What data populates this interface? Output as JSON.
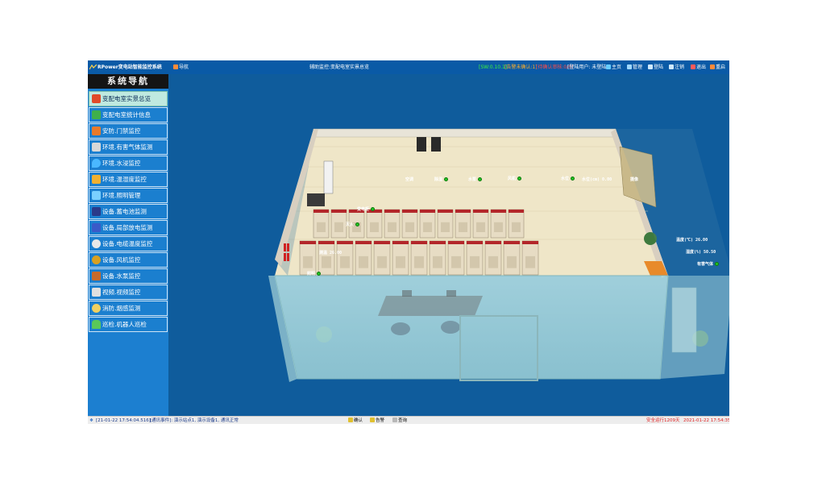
{
  "window": {
    "title": "RPower变电站智能监控系统",
    "nav_button": "导航",
    "center_title": "辅助监控:变配电室实景总览",
    "status_green": "[SW:0.10.1]",
    "status_orange": "[告警未确认:1]",
    "status_red": "[待确认审核:0/0]",
    "login_label": "[登陆用户: 未登陆]",
    "menu": [
      "主页",
      "管理",
      "登陆",
      "注销",
      "退出",
      "重启"
    ]
  },
  "sidebar": {
    "title": "系统导航",
    "items": [
      {
        "label": "变配电室实景总览",
        "icon": "substation-icon",
        "active": true
      },
      {
        "label": "变配电室统计信息",
        "icon": "statistics-icon"
      },
      {
        "label": "安防.门禁监控",
        "icon": "door-access-icon"
      },
      {
        "label": "环境.有害气体监测",
        "icon": "gas-icon"
      },
      {
        "label": "环境.水浸监控",
        "icon": "water-drop-icon"
      },
      {
        "label": "环境.温湿度监控",
        "icon": "thermometer-icon"
      },
      {
        "label": "环境.照明管理",
        "icon": "lighting-icon"
      },
      {
        "label": "设备.蓄电池监测",
        "icon": "battery-icon"
      },
      {
        "label": "设备.局部放电监测",
        "icon": "discharge-icon"
      },
      {
        "label": "设备.电缆温度监控",
        "icon": "cable-gauge-icon"
      },
      {
        "label": "设备.风机监控",
        "icon": "fan-icon"
      },
      {
        "label": "设备.水泵监控",
        "icon": "pump-icon"
      },
      {
        "label": "视频.视频监控",
        "icon": "camera-icon"
      },
      {
        "label": "消防.烟感监测",
        "icon": "smoke-detector-icon"
      },
      {
        "label": "巡检.机器人巡检",
        "icon": "robot-icon"
      }
    ]
  },
  "scene": {
    "labels": [
      {
        "text": "空调",
        "dot": false
      },
      {
        "text": "除湿",
        "dot": true
      },
      {
        "text": "水泵",
        "dot": true
      },
      {
        "text": "风机",
        "dot": true
      },
      {
        "text": "水位",
        "dot": true
      },
      {
        "text": "水位(cm) 0.00",
        "dot": false
      },
      {
        "text": "摄像",
        "dot": false
      },
      {
        "text": "变电柜",
        "dot": true
      },
      {
        "text": "灭火",
        "dot": true
      },
      {
        "text": "测温 26.00",
        "dot": false
      },
      {
        "text": "照明",
        "dot": true
      },
      {
        "text": "温度(℃) 26.00",
        "dot": false
      },
      {
        "text": "湿度(%) 50.50",
        "dot": false
      },
      {
        "text": "有害气体",
        "dot": true
      },
      {
        "text": "门禁",
        "dot": true
      }
    ]
  },
  "statusbar": {
    "datetime": "[21-01-22 17:54:04.516]:",
    "message": "[通讯事件]: 演示站点1, 演示设备1, 通讯正常",
    "btn_confirm": "确认",
    "btn_alarm": "告警",
    "btn_query": "查询",
    "uptime": "安全运行1209天",
    "clock": "2021-01-22 17:54:35"
  },
  "colors": {
    "accent": "#0a5aa6",
    "sidebar": "#1b7fcf",
    "active_item": "#bfe9e0",
    "status_ok": "#22c422",
    "alert_red": "#e02020"
  }
}
